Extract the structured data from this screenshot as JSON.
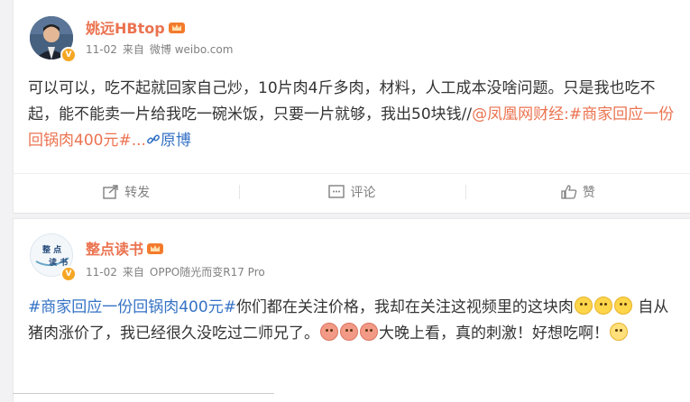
{
  "post1": {
    "username": "姚远HBtop",
    "date": "11-02",
    "from_label": "来自",
    "source": "微博 weibo.com",
    "text_main": "可以可以，吃不起就回家自己炒，10片肉4斤多肉，材料，人工成本没啥问题。只是我也吃不起，能不能卖一片给我吃一碗米饭，只要一片就够，我出50块钱//",
    "mention": "@凤凰网财经",
    "colon": ":",
    "hashtag": "#商家回应一份回锅肉400元#...",
    "orig_label": "原博",
    "actions": {
      "repost": "转发",
      "comment": "评论",
      "like": "赞"
    }
  },
  "post2": {
    "username": "整点读书",
    "avatar_text": "整点\n读书",
    "date": "11-02",
    "from_label": "来自",
    "source": "OPPO随光而变R17 Pro",
    "hashtag": "#商家回应一份回锅肉400元#",
    "text_a": "你们都在关注价格，我却在关注这视频里的这块肉",
    "text_b": "自从猪肉涨价了，我已经很久没吃过二师兄了。",
    "text_c": "大晚上看，真的刺激！好想吃啊！"
  },
  "colors": {
    "username": "#eb7350",
    "link": "#3472c5",
    "badge": "#f5a623"
  }
}
